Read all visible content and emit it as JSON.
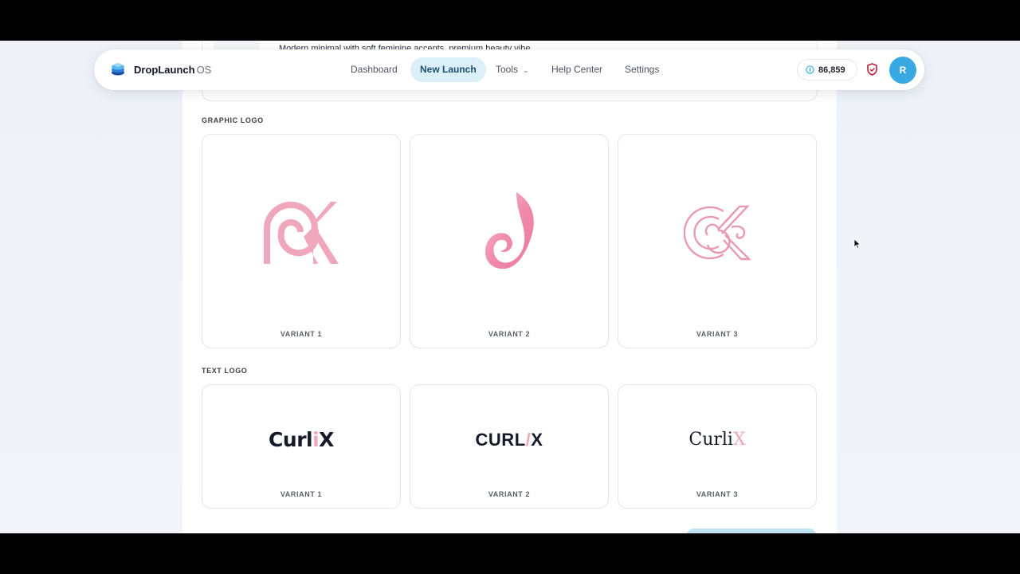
{
  "app": {
    "brand_name": "DropLaunch",
    "brand_suffix": "OS"
  },
  "nav": {
    "items": [
      {
        "label": "Dashboard"
      },
      {
        "label": "New Launch",
        "active": true
      },
      {
        "label": "Tools",
        "has_dropdown": true
      },
      {
        "label": "Help Center"
      },
      {
        "label": "Settings"
      }
    ],
    "credits": "86,859",
    "avatar_initial": "R"
  },
  "previous_card": {
    "description": "Modern minimal with soft feminine accents, premium beauty vibe"
  },
  "graphic_logo": {
    "section_label": "GRAPHIC LOGO",
    "variants": [
      {
        "label": "VARIANT 1",
        "icon": "swirl-rk-monogram-icon"
      },
      {
        "label": "VARIANT 2",
        "icon": "pink-flame-swirl-icon"
      },
      {
        "label": "VARIANT 3",
        "icon": "outline-ck-monogram-icon"
      }
    ]
  },
  "text_logo": {
    "section_label": "TEXT LOGO",
    "variants": [
      {
        "label": "VARIANT 1",
        "word_main": "Curl",
        "word_accent": "i",
        "word_end": "X"
      },
      {
        "label": "VARIANT 2",
        "word_main": "CURL",
        "word_accent": "/",
        "word_end": "X"
      },
      {
        "label": "VARIANT 3",
        "word_main": "Curli",
        "word_accent": "X",
        "word_end": ""
      }
    ]
  },
  "colors": {
    "accent": "#38a9e3",
    "active_tab_bg": "#dbeff8",
    "logo_pink": "#f0a7bc",
    "shield_red": "#b91c3a"
  }
}
